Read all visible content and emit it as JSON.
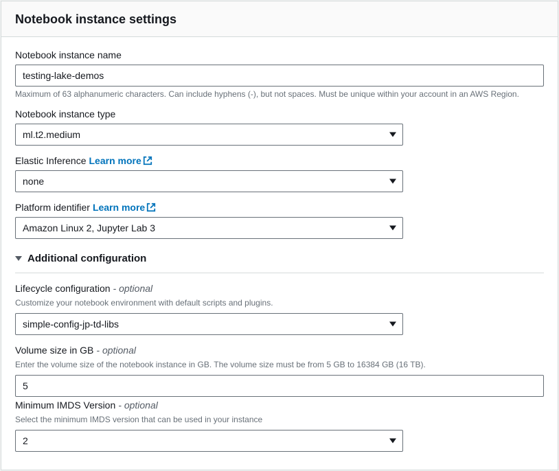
{
  "title": "Notebook instance settings",
  "name": {
    "label": "Notebook instance name",
    "value": "testing-lake-demos",
    "helper": "Maximum of 63 alphanumeric characters. Can include hyphens (-), but not spaces. Must be unique within your account in an AWS Region."
  },
  "type": {
    "label": "Notebook instance type",
    "value": "ml.t2.medium"
  },
  "elastic": {
    "label": "Elastic Inference",
    "learnMore": "Learn more",
    "value": "none"
  },
  "platform": {
    "label": "Platform identifier",
    "learnMore": "Learn more",
    "value": "Amazon Linux 2, Jupyter Lab 3"
  },
  "additional": {
    "toggle": "Additional configuration",
    "lifecycle": {
      "label": "Lifecycle configuration",
      "optional": "- optional",
      "helper": "Customize your notebook environment with default scripts and plugins.",
      "value": "simple-config-jp-td-libs"
    },
    "volume": {
      "label": "Volume size in GB",
      "optional": "- optional",
      "helper": "Enter the volume size of the notebook instance in GB. The volume size must be from 5 GB to 16384 GB (16 TB).",
      "value": "5"
    },
    "imds": {
      "label": "Minimum IMDS Version",
      "optional": "- optional",
      "helper": "Select the minimum IMDS version that can be used in your instance",
      "value": "2"
    }
  }
}
